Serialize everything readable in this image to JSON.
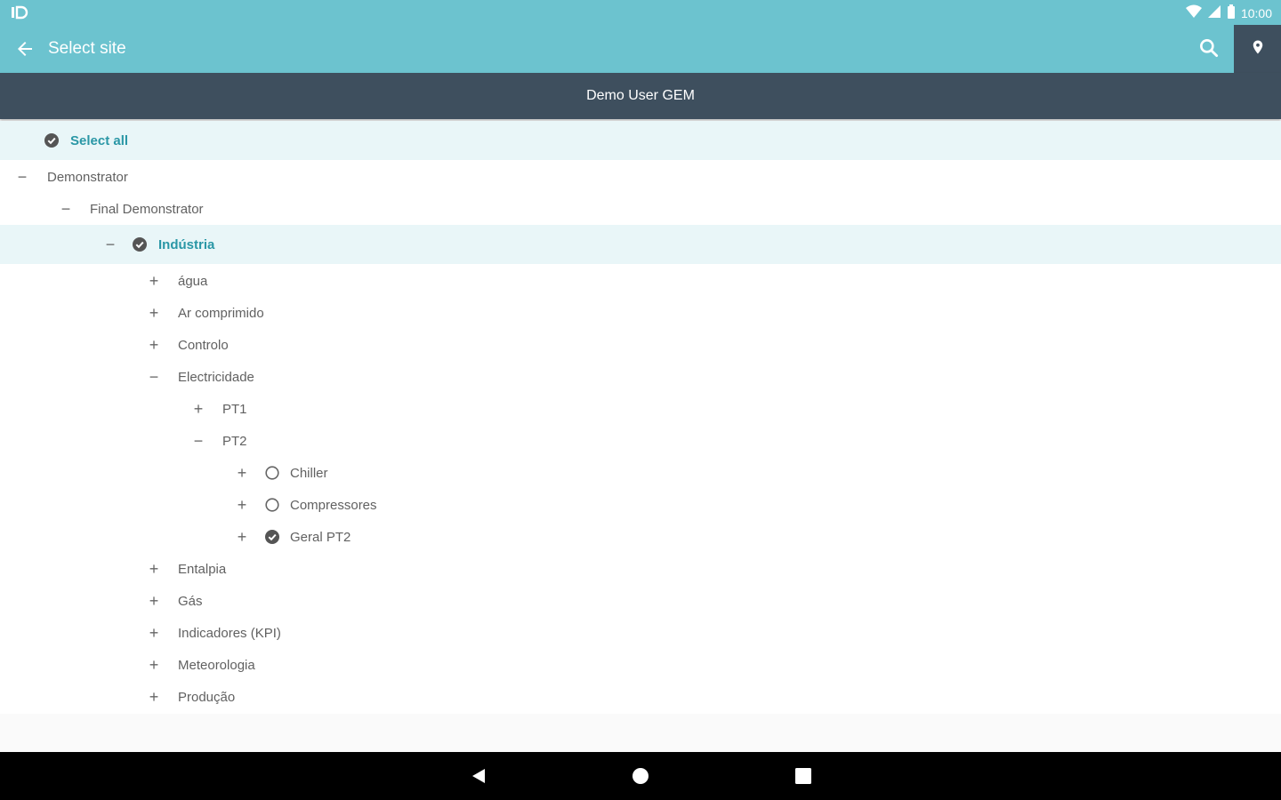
{
  "status_bar": {
    "left_icon": "sim-icon",
    "time": "10:00"
  },
  "app_bar": {
    "title": "Select site",
    "back_icon": "arrow-back-icon",
    "search_icon": "search-icon",
    "map_icon": "map-pin-icon"
  },
  "subheader": {
    "user": "Demo User GEM"
  },
  "tree": {
    "select_all": {
      "label": "Select all",
      "checked": true
    },
    "nodes": [
      {
        "label": "Demonstrator",
        "sign": "−"
      },
      {
        "label": "Final Demonstrator",
        "sign": "−"
      },
      {
        "label": "Indústria",
        "sign": "−",
        "checked": true
      },
      {
        "label": "água",
        "sign": "+"
      },
      {
        "label": "Ar comprimido",
        "sign": "+"
      },
      {
        "label": "Controlo",
        "sign": "+"
      },
      {
        "label": "Electricidade",
        "sign": "−"
      },
      {
        "label": "PT1",
        "sign": "+"
      },
      {
        "label": "PT2",
        "sign": "−"
      },
      {
        "label": "Chiller",
        "sign": "+",
        "checked": false
      },
      {
        "label": "Compressores",
        "sign": "+",
        "checked": false
      },
      {
        "label": "Geral PT2",
        "sign": "+",
        "checked": true
      },
      {
        "label": "Entalpia",
        "sign": "+"
      },
      {
        "label": "Gás",
        "sign": "+"
      },
      {
        "label": "Indicadores (KPI)",
        "sign": "+"
      },
      {
        "label": "Meteorologia",
        "sign": "+"
      },
      {
        "label": "Produção",
        "sign": "+"
      }
    ]
  },
  "colors": {
    "primary": "#6cc3cf",
    "dark": "#3e4f5e",
    "accent": "#2a97a6",
    "highlight": "#e9f6f8"
  },
  "nav_bar": {
    "back_icon": "nav-back-icon",
    "home_icon": "nav-home-icon",
    "recents_icon": "nav-recents-icon"
  }
}
